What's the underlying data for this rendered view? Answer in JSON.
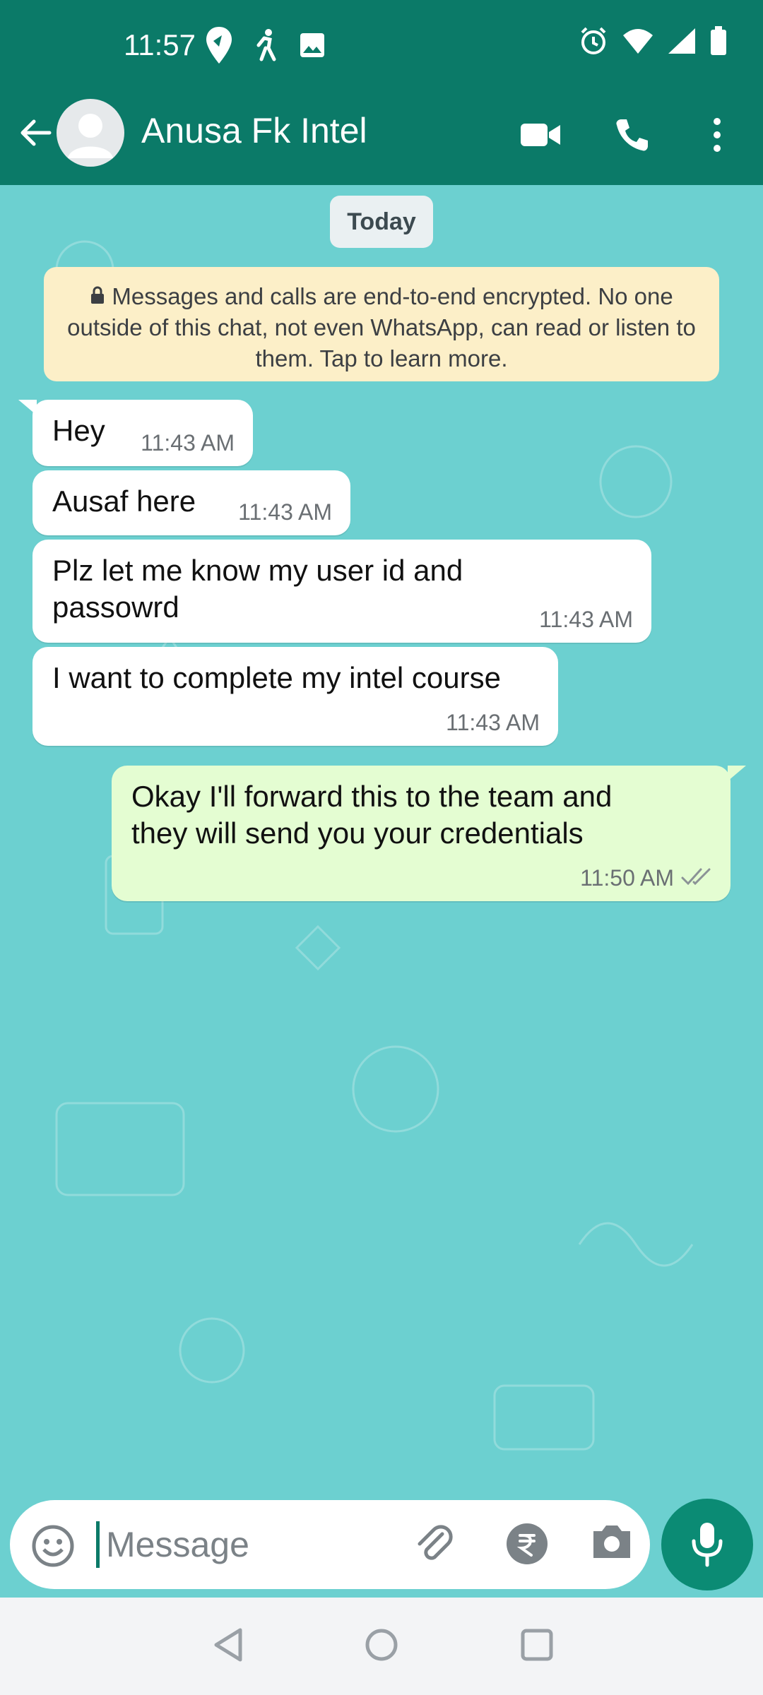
{
  "status": {
    "time": "11:57"
  },
  "header": {
    "title": "Anusa Fk Intel"
  },
  "chat": {
    "date_chip": "Today",
    "encryption_notice": "Messages and calls are end-to-end encrypted. No one outside of this chat, not even WhatsApp, can read or listen to them. Tap to learn more.",
    "messages": [
      {
        "text": "Hey",
        "time": "11:43 AM",
        "direction": "incoming"
      },
      {
        "text": "Ausaf here",
        "time": "11:43 AM",
        "direction": "incoming"
      },
      {
        "text": "Plz let me know my user id and passowrd",
        "time": "11:43 AM",
        "direction": "incoming"
      },
      {
        "text": "I want to complete my intel course",
        "time": "11:43 AM",
        "direction": "incoming"
      },
      {
        "text": "Okay I'll forward this to the team and they will send you your credentials",
        "time": "11:50 AM",
        "direction": "outgoing"
      }
    ]
  },
  "input": {
    "placeholder": "Message"
  },
  "icons": {
    "back": "arrow-left-icon",
    "video": "video-camera-icon",
    "call": "phone-icon",
    "more": "more-vertical-icon",
    "emoji": "emoji-icon",
    "attach": "paperclip-icon",
    "payment": "rupee-icon",
    "camera": "camera-icon",
    "mic": "microphone-icon",
    "read": "double-check-icon"
  },
  "colors": {
    "header": "#0b7a68",
    "chat_bg": "#6cd0d0",
    "incoming": "#ffffff",
    "outgoing": "#e4fdd2",
    "accent": "#0b8b74"
  }
}
